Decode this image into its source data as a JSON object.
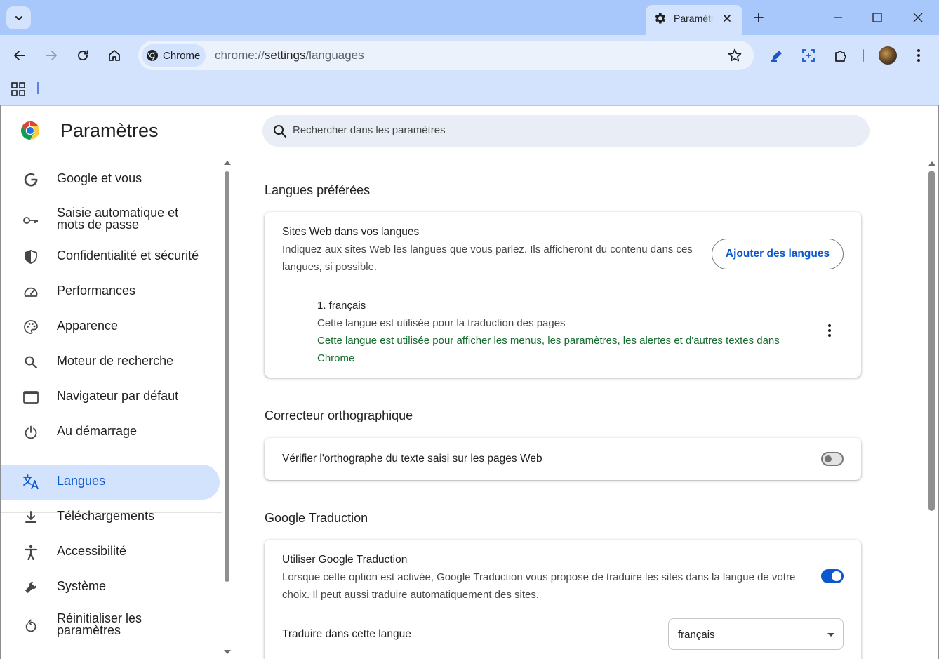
{
  "tab": {
    "title": "Paramètres"
  },
  "toolbar": {
    "chip_label": "Chrome",
    "url_scheme": "chrome://",
    "url_host": "settings",
    "url_path": "/languages"
  },
  "settings": {
    "title": "Paramètres",
    "search_placeholder": "Rechercher dans les paramètres"
  },
  "sidebar": {
    "items": [
      {
        "label": "Google et vous",
        "icon": "google-g-icon"
      },
      {
        "label": "Saisie automatique et mots de passe",
        "icon": "key-icon"
      },
      {
        "label": "Confidentialité et sécurité",
        "icon": "shield-icon"
      },
      {
        "label": "Performances",
        "icon": "speedometer-icon"
      },
      {
        "label": "Apparence",
        "icon": "palette-icon"
      },
      {
        "label": "Moteur de recherche",
        "icon": "search-icon"
      },
      {
        "label": "Navigateur par défaut",
        "icon": "browser-window-icon"
      },
      {
        "label": "Au démarrage",
        "icon": "power-icon"
      },
      {
        "label": "Langues",
        "icon": "translate-icon",
        "active": true
      },
      {
        "label": "Téléchargements",
        "icon": "download-icon"
      },
      {
        "label": "Accessibilité",
        "icon": "accessibility-icon"
      },
      {
        "label": "Système",
        "icon": "wrench-icon"
      },
      {
        "label": "Réinitialiser les paramètres",
        "icon": "reset-icon"
      }
    ]
  },
  "preferred_languages": {
    "title": "Langues préférées",
    "card_title": "Sites Web dans vos langues",
    "card_sub": "Indiquez aux sites Web les langues que vous parlez. Ils afficheront du contenu dans ces langues, si possible.",
    "add_button": "Ajouter des langues",
    "languages": [
      {
        "name": "1. français",
        "translate_note": "Cette langue est utilisée pour la traduction des pages",
        "ui_note": "Cette langue est utilisée pour afficher les menus, les paramètres, les alertes et d'autres textes dans Chrome"
      }
    ]
  },
  "spellcheck": {
    "title": "Correcteur orthographique",
    "row_label": "Vérifier l'orthographe du texte saisi sur les pages Web",
    "enabled": false
  },
  "google_translate": {
    "title": "Google Traduction",
    "row_title": "Utiliser Google Traduction",
    "row_sub": "Lorsque cette option est activée, Google Traduction vous propose de traduire les sites dans la langue de votre choix. Il peut aussi traduire automatiquement des sites.",
    "enabled": true,
    "target_label": "Traduire dans cette langue",
    "target_value": "français"
  },
  "colors": {
    "accent": "#0b57d0",
    "frame": "#a8c7fa",
    "toolbar": "#d3e3fd",
    "ui_language_note": "#146c2e"
  }
}
